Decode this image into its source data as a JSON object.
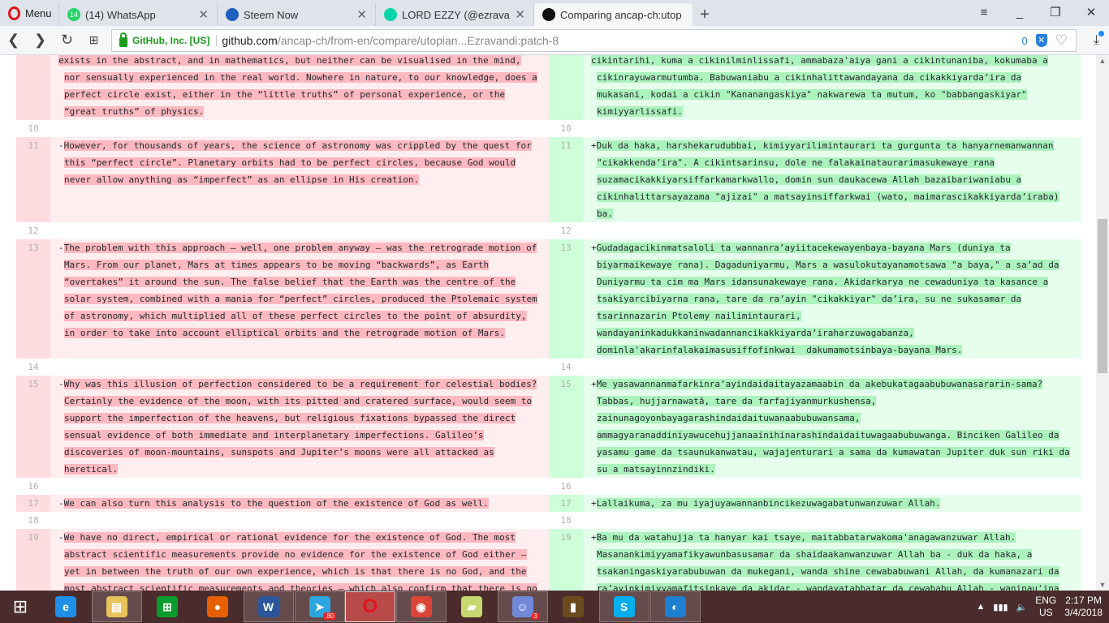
{
  "browser": {
    "menu_label": "Menu",
    "tabs": [
      {
        "title": "(14) WhatsApp",
        "badge": "14",
        "color": "#25d366"
      },
      {
        "title": "Steem Now",
        "color": "#1f5fbf"
      },
      {
        "title": "LORD EZZY (@ezravandi) -",
        "color": "#06d6a9"
      },
      {
        "title": "Comparing ancap-ch:utop",
        "color": "#111111",
        "active": true
      }
    ],
    "new_tab": "+",
    "org": "GitHub, Inc. [US]",
    "url_host": "github.com",
    "url_path": "/ancap-ch/from-en/compare/utopian...Ezravandi:patch-8",
    "blocked_count": "0"
  },
  "diff": {
    "rows": [
      {
        "left": {
          "num": "",
          "lines": [
            "exists in the abstract, and in mathematics, but neither can be visualised in the mind,",
            "nor sensually experienced in the real world. Nowhere in nature, to our knowledge, does a",
            "perfect circle exist, either in the “little truths” of personal experience, or the",
            "“great truths” of physics."
          ]
        },
        "right": {
          "num": "",
          "lines": [
            "cikintarihi, kuma a cikinilminlissafi, ammabaza'aiya gani a cikintunaniba, kokumaba a",
            "cikinrayuwarmutumba. Babuwaniabu a cikinhalittawandayana da cikakkiyarda’ira da",
            "mukasani, kodai a cikin \"Kananangaskiya\" nakwarewa ta mutum, ko \"babbangaskiyar\"",
            "kimiyyarlissafi."
          ]
        }
      },
      {
        "empty": true,
        "left": {
          "num": "10",
          "lines": [
            ""
          ]
        },
        "right": {
          "num": "10",
          "lines": [
            ""
          ]
        }
      },
      {
        "left": {
          "num": "11",
          "lines": [
            "-However, for thousands of years, the science of astronomy was crippled by the quest for",
            "this “perfect circle”. Planetary orbits had to be perfect circles, because God would",
            "never allow anything as “imperfect” as an ellipse in His creation."
          ]
        },
        "right": {
          "num": "11",
          "lines": [
            "+Duk da haka, harshekarudubbai, kimiyyarilimintaurari ta gurgunta ta hanyarnemanwannan",
            "\"cikakkenda’ira\". A cikintsarinsu, dole ne falakainataurarimasukewaye rana",
            "suzamacikakkiyarsiffarkamarkwallo, domin sun daukacewa Allah bazaibariwaniabu a",
            "cikinhalittarsayazama \"ajizai\" a matsayinsiffarkwai (wato, maimarascikakkiyarda’iraba)",
            "ba."
          ]
        }
      },
      {
        "empty": true,
        "left": {
          "num": "12",
          "lines": [
            ""
          ]
        },
        "right": {
          "num": "12",
          "lines": [
            ""
          ]
        }
      },
      {
        "left": {
          "num": "13",
          "lines": [
            "-The problem with this approach – well, one problem anyway – was the retrograde motion of",
            "Mars. From our planet, Mars at times appears to be moving “backwards”, as Earth",
            "“overtakes” it around the sun. The false belief that the Earth was the centre of the",
            "solar system, combined with a mania for “perfect” circles, produced the Ptolemaic system",
            "of astronomy, which multiplied all of these perfect circles to the point of absurdity,",
            "in order to take into account elliptical orbits and the retrograde motion of Mars."
          ]
        },
        "right": {
          "num": "13",
          "lines": [
            "+Gudadagacikinmatsaloli ta wannanra’ayiitacekewayenbaya-bayana Mars (duniya ta",
            "biyarmaikewaye rana). Dagaduniyarmu, Mars a wasulokutayanamotsawa \"a baya,\" a sa’ad da",
            "Duniyarmu ta cim ma Mars idansunakewaye rana. Akidarkarya ne cewaduniya ta kasance a",
            "tsakiyarcibiyarna rana, tare da ra’ayin \"cikakkiyar\" da’ira, su ne sukasamar da",
            "tsarinnazarin Ptolemy nailimintaurari,",
            "wandayaninkadukkaninwadannancikakkiyarda’iraharzuwagabanza,",
            "dominla'akarinfalakaimasusiffofinkwai  dakumamotsinbaya-bayana Mars."
          ]
        }
      },
      {
        "empty": true,
        "left": {
          "num": "14",
          "lines": [
            ""
          ]
        },
        "right": {
          "num": "14",
          "lines": [
            ""
          ]
        }
      },
      {
        "left": {
          "num": "15",
          "lines": [
            "-Why was this illusion of perfection considered to be a requirement for celestial bodies?",
            "Certainly the evidence of the moon, with its pitted and cratered surface, would seem to",
            "support the imperfection of the heavens, but religious fixations bypassed the direct",
            "sensual evidence of both immediate and interplanetary imperfections. Galileo’s",
            "discoveries of moon-mountains, sunspots and Jupiter’s moons were all attacked as",
            "heretical."
          ]
        },
        "right": {
          "num": "15",
          "lines": [
            "+Me yasawannanmafarkinra’ayindaidaitayazamaabin da akebukatagaabubuwanasararin-sama?",
            "Tabbas, hujjarnawatã, tare da farfajiyanmurkushensa,",
            "zainunagoyonbayagarashindaidaituwanaabubuwansama,",
            "ammagyaranaddiniyawucehujjanaainihinarashindaidaituwagaabubuwanga. Binciken Galileo da",
            "yasamu game da tsaunukanwatau, wajajenturari a sama da kumawatan Jupiter duk sun riki da",
            "su a matsayinnzindiki."
          ]
        }
      },
      {
        "empty": true,
        "left": {
          "num": "16",
          "lines": [
            ""
          ]
        },
        "right": {
          "num": "16",
          "lines": [
            ""
          ]
        }
      },
      {
        "left": {
          "num": "17",
          "lines": [
            "-We can also turn this analysis to the question of the existence of God as well."
          ]
        },
        "right": {
          "num": "17",
          "lines": [
            "+Lallaikuma, za mu iyajuyawannanbincikezuwagabatunwanzuwar Allah."
          ]
        }
      },
      {
        "empty": true,
        "left": {
          "num": "18",
          "lines": [
            ""
          ]
        },
        "right": {
          "num": "18",
          "lines": [
            ""
          ]
        }
      },
      {
        "left": {
          "num": "19",
          "lines": [
            "-We have no direct, empirical or rational evidence for the existence of God. The most",
            "abstract scientific measurements provide no evidence for the existence of God either –",
            "yet in between the truth of our own experience, which is that there is no God, and the",
            "most abstract scientific measurements and theories – which also confirm that there is no"
          ]
        },
        "right": {
          "num": "19",
          "lines": [
            "+Ba mu da watahujja ta hanyar kai tsaye, maitabbatarwakoma'anagawanzuwar Allah.",
            "Masanankimiyyamafikyawunbasusamar da shaidaakanwanzuwar Allah ba - duk da haka, a",
            "tsakaningaskiyarabubuwan da mukegani, wanda shine cewababuwani Allah, da kumanazari da",
            "ra’ayinkimiyyamafitsinkaye da akidar - wandayatabbatar da cewababu Allah - wanipau'ina"
          ]
        }
      }
    ]
  },
  "taskbar": {
    "apps": [
      {
        "name": "internet-explorer",
        "glyph": "e",
        "color": "#1e90e8"
      },
      {
        "name": "file-explorer",
        "glyph": "▤",
        "color": "#e8c35a",
        "boxed": true
      },
      {
        "name": "store",
        "glyph": "⊞",
        "color": "#0a9b2e"
      },
      {
        "name": "firefox",
        "glyph": "●",
        "color": "#e66000"
      },
      {
        "name": "word",
        "glyph": "W",
        "color": "#2b579a",
        "boxed": true
      },
      {
        "name": "telegram",
        "glyph": "➤",
        "color": "#2ca5e0",
        "boxed": true,
        "badge": ".80"
      },
      {
        "name": "opera",
        "glyph": "O",
        "color": "#e0141e",
        "opera": true
      },
      {
        "name": "chrome",
        "glyph": "◉",
        "color": "#db4437",
        "boxed": true
      },
      {
        "name": "sticky-notes",
        "glyph": "▰",
        "color": "#c8d870"
      },
      {
        "name": "discord",
        "glyph": "☺",
        "color": "#7289da",
        "boxed": true,
        "badge": "3"
      },
      {
        "name": "book",
        "glyph": "▮",
        "color": "#6b4a1e"
      },
      {
        "name": "skype",
        "glyph": "S",
        "color": "#00aff0",
        "boxed": true
      },
      {
        "name": "edge-app",
        "glyph": "◐",
        "color": "#1e7fd0",
        "boxed": true
      }
    ],
    "lang": "ENG",
    "region": "US",
    "time": "2:17 PM",
    "date": "3/4/2018"
  }
}
